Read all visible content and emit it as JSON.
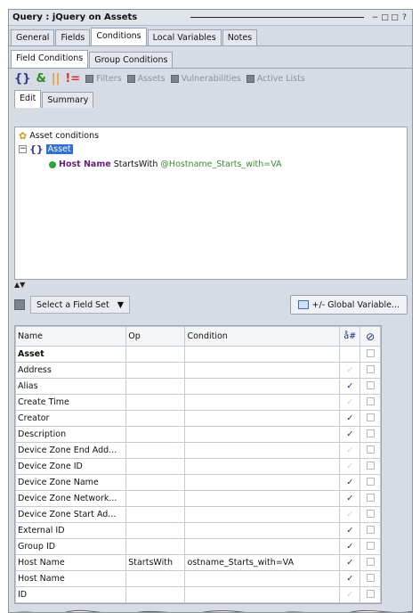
{
  "window": {
    "title": "Query : jQuery on Assets",
    "controls": [
      "−",
      "□",
      "□",
      "?"
    ]
  },
  "main_tabs": [
    "General",
    "Fields",
    "Conditions",
    "Local Variables",
    "Notes"
  ],
  "sub_tabs": [
    "Field Conditions",
    "Group Conditions"
  ],
  "toolbar": {
    "items": [
      "Filters",
      "Assets",
      "Vulnerabilities",
      "Active Lists"
    ]
  },
  "editor_tabs": [
    "Edit",
    "Summary"
  ],
  "tree": {
    "root_label": "Asset conditions",
    "node_label": "Asset",
    "condition_field": "Host Name",
    "condition_op": "StartsWith",
    "condition_value": "@Hostname_Starts_with=VA"
  },
  "field_set": {
    "selected": "Select a Field Set",
    "global_variable_button": "+/- Global Variable..."
  },
  "grid": {
    "columns": [
      "Name",
      "Op",
      "Condition",
      "å#",
      "⊘"
    ],
    "rows": [
      {
        "name": "Asset",
        "op": "",
        "cond": "",
        "check": "",
        "disabled": false,
        "group": true
      },
      {
        "name": "Address",
        "op": "",
        "cond": "",
        "check": "✓",
        "disabled": true,
        "group": false
      },
      {
        "name": "Alias",
        "op": "",
        "cond": "",
        "check": "✓",
        "disabled": false,
        "group": false
      },
      {
        "name": "Create Time",
        "op": "",
        "cond": "",
        "check": "✓",
        "disabled": true,
        "group": false
      },
      {
        "name": "Creator",
        "op": "",
        "cond": "",
        "check": "✓",
        "disabled": false,
        "group": false
      },
      {
        "name": "Description",
        "op": "",
        "cond": "",
        "check": "✓",
        "disabled": false,
        "group": false
      },
      {
        "name": "Device Zone End Add...",
        "op": "",
        "cond": "",
        "check": "✓",
        "disabled": true,
        "group": false
      },
      {
        "name": "Device Zone ID",
        "op": "",
        "cond": "",
        "check": "✓",
        "disabled": true,
        "group": false
      },
      {
        "name": "Device Zone Name",
        "op": "",
        "cond": "",
        "check": "✓",
        "disabled": false,
        "group": false
      },
      {
        "name": "Device Zone Network...",
        "op": "",
        "cond": "",
        "check": "✓",
        "disabled": false,
        "group": false
      },
      {
        "name": "Device Zone Start Ad...",
        "op": "",
        "cond": "",
        "check": "✓",
        "disabled": true,
        "group": false
      },
      {
        "name": "External ID",
        "op": "",
        "cond": "",
        "check": "✓",
        "disabled": false,
        "group": false
      },
      {
        "name": "Group ID",
        "op": "",
        "cond": "",
        "check": "✓",
        "disabled": false,
        "group": false
      },
      {
        "name": "Host Name",
        "op": "StartsWith",
        "cond": "ostname_Starts_with=VA",
        "check": "✓",
        "disabled": false,
        "group": false
      },
      {
        "name": "Host Name",
        "op": "",
        "cond": "",
        "check": "✓",
        "disabled": false,
        "group": false
      },
      {
        "name": "ID",
        "op": "",
        "cond": "",
        "check": "✓",
        "disabled": true,
        "group": false
      }
    ]
  }
}
